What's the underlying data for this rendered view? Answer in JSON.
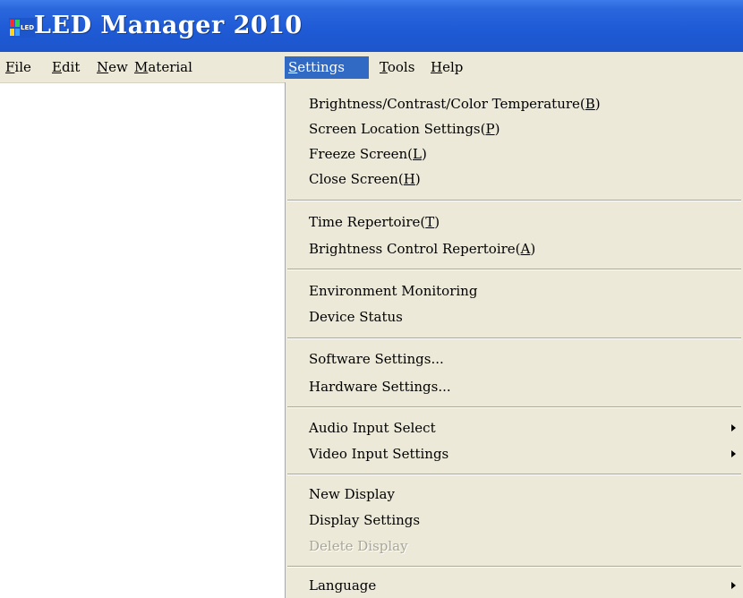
{
  "window": {
    "title": "LED Manager 2010",
    "logo_text": "LED",
    "logo_colors": [
      "#ff2a2a",
      "#ffd21e",
      "#2fd14a",
      "#3aa0ff"
    ]
  },
  "menubar": {
    "items": [
      {
        "mnemonic": "F",
        "rest": "ile"
      },
      {
        "mnemonic": "E",
        "rest": "dit"
      },
      {
        "mnemonic": "N",
        "rest": "ew"
      },
      {
        "mnemonic": "M",
        "rest": "aterial"
      },
      {
        "mnemonic": "S",
        "rest": "ettings"
      },
      {
        "mnemonic": "T",
        "rest": "ools"
      },
      {
        "mnemonic": "H",
        "rest": "elp"
      }
    ],
    "active_index": 4
  },
  "settings_menu": {
    "items": [
      {
        "label": "Brightness/Contrast/Color Temperature(",
        "mnemonic": "B",
        "close": ")"
      },
      {
        "label": "Screen Location Settings(",
        "mnemonic": "P",
        "close": ")"
      },
      {
        "label": "Freeze Screen(",
        "mnemonic": "L",
        "close": ")"
      },
      {
        "label": "Close Screen(",
        "mnemonic": "H",
        "close": ")"
      },
      {
        "label": "Time Repertoire(",
        "mnemonic": "T",
        "close": ")"
      },
      {
        "label": "Brightness Control Repertoire(",
        "mnemonic": "A",
        "close": ")"
      },
      {
        "label": "Environment Monitoring"
      },
      {
        "label": "Device Status"
      },
      {
        "label": "Software Settings..."
      },
      {
        "label": "Hardware Settings..."
      },
      {
        "label": "Audio Input Select",
        "submenu": true
      },
      {
        "label": "Video Input Settings",
        "submenu": true
      },
      {
        "label": "New Display"
      },
      {
        "label": "Display Settings"
      },
      {
        "label": "Delete Display",
        "disabled": true
      },
      {
        "label": "Language",
        "submenu": true
      }
    ]
  },
  "colors": {
    "titlebar": "#2a66dc",
    "menu_background": "#ece9d8",
    "highlight": "#316ac5",
    "disabled_text": "#a9a698"
  }
}
